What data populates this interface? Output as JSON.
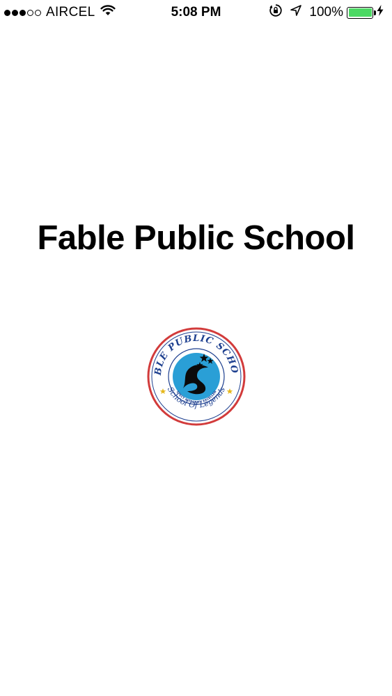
{
  "status_bar": {
    "signal_bars_filled": 3,
    "signal_bars_total": 5,
    "carrier": "AIRCEL",
    "time": "5:08 PM",
    "battery_percent": "100%",
    "battery_level": 1.0,
    "battery_color": "#4cd964",
    "icons": [
      "wifi-icon",
      "orientation-lock-icon",
      "location-arrow-icon",
      "battery-icon",
      "charging-bolt-icon"
    ]
  },
  "main": {
    "title": "Fable Public School",
    "logo": {
      "top_text": "FABLE PUBLIC SCHOOL",
      "motto": "RESPECT INTEGRITY EXCELLENCE",
      "bottom_text": "School Of Legends",
      "ring_color": "#d23b3b",
      "emblem_color": "#2a9fd6"
    }
  }
}
